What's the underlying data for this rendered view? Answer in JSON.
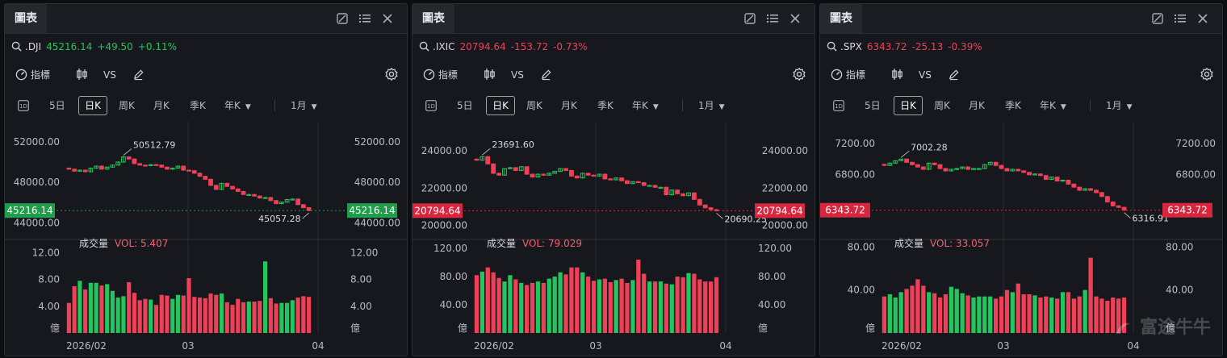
{
  "colors": {
    "up": "#22c55e",
    "down": "#ef4058",
    "grid": "#2a2c33",
    "label_green": "#1f9d4a",
    "label_red": "#d8263e"
  },
  "ui": {
    "tab_label": "圖表",
    "search_icon": "search-icon",
    "indicator_label": "指標",
    "vs_label": "VS",
    "periods": [
      "5日",
      "日K",
      "周K",
      "月K",
      "季K",
      "年K",
      "1月"
    ],
    "active_period": "日K",
    "volume_label": "成交量",
    "unit_label": "億",
    "x_labels": [
      "2026/02",
      "03",
      "04"
    ]
  },
  "watermark": "富途牛牛",
  "panels": [
    {
      "symbol": ".DJI",
      "price": "45216.14",
      "change": "+49.50",
      "change_pct": "+0.11%",
      "direction": "up",
      "y_ticks": [
        "52000.00",
        "48000.00",
        "44000.00"
      ],
      "current_label": "45216.14",
      "high_label": "50512.79",
      "low_label": "45057.28",
      "vol_text": "VOL: 5.407",
      "vol_ticks": [
        "12.00",
        "8.00",
        "4.00"
      ],
      "chart_data": {
        "type": "candlestick",
        "ylim": [
          43000,
          53500
        ],
        "vol_max": 13.5,
        "closes": [
          49300,
          49100,
          49200,
          49050,
          49400,
          49600,
          49300,
          49500,
          49700,
          50000,
          50513,
          50300,
          49850,
          49700,
          49650,
          49750,
          49700,
          49500,
          49300,
          49400,
          49600,
          49200,
          49150,
          48900,
          48600,
          48300,
          47700,
          47300,
          47900,
          47600,
          47350,
          47100,
          46800,
          46800,
          46650,
          46450,
          46500,
          46200,
          45900,
          46050,
          46300,
          46350,
          45800,
          45500,
          45216
        ],
        "volumes": [
          4.5,
          7.0,
          7.8,
          6.5,
          7.5,
          7.5,
          7.1,
          7.3,
          6.3,
          5.3,
          5.5,
          7.6,
          6.0,
          4.9,
          5.1,
          5.0,
          4.2,
          5.7,
          5.6,
          5.1,
          5.7,
          5.6,
          8.2,
          5.4,
          5.3,
          5.2,
          5.9,
          5.7,
          5.9,
          4.6,
          4.2,
          5.1,
          4.6,
          4.7,
          4.7,
          4.8,
          10.7,
          5.2,
          4.4,
          4.5,
          4.5,
          4.9,
          5.3,
          5.5,
          5.4
        ]
      }
    },
    {
      "symbol": ".IXIC",
      "price": "20794.64",
      "change": "-153.72",
      "change_pct": "-0.73%",
      "direction": "down",
      "y_ticks": [
        "24000.00",
        "22000.00",
        "20000.00"
      ],
      "current_label": "20794.64",
      "high_label": "23691.60",
      "low_label": "20690.25",
      "vol_text": "VOL: 79.029",
      "vol_ticks": [
        "120.00",
        "80.00",
        "40.00"
      ],
      "chart_data": {
        "type": "candlestick",
        "ylim": [
          19600,
          25300
        ],
        "vol_max": 128,
        "closes": [
          23500,
          23692,
          23300,
          22800,
          22700,
          23050,
          23100,
          22950,
          23150,
          22750,
          22600,
          22750,
          22700,
          22800,
          22900,
          23050,
          22950,
          22650,
          22550,
          22800,
          22700,
          22650,
          22750,
          22500,
          22450,
          22550,
          22400,
          22250,
          22350,
          22300,
          22150,
          22150,
          22050,
          22050,
          21650,
          21900,
          21700,
          21600,
          21750,
          21400,
          21100,
          20950,
          20850,
          20794
        ],
        "volumes": [
          82,
          87,
          93,
          86,
          78,
          73,
          82,
          76,
          71,
          68,
          71,
          73,
          71,
          77,
          80,
          86,
          83,
          93,
          93,
          86,
          80,
          74,
          76,
          77,
          72,
          75,
          77,
          71,
          75,
          104,
          84,
          73,
          73,
          73,
          70,
          69,
          80,
          79,
          85,
          84,
          76,
          73,
          73,
          79
        ]
      }
    },
    {
      "symbol": ".SPX",
      "price": "6343.72",
      "change": "-25.13",
      "change_pct": "-0.39%",
      "direction": "down",
      "y_ticks": [
        "7200.00",
        "6800.00"
      ],
      "current_label": "6343.72",
      "high_label": "7002.28",
      "low_label": "6316.91",
      "vol_text": "VOL: 33.057",
      "vol_ticks": [
        "80.00",
        "40.00"
      ],
      "chart_data": {
        "type": "candlestick",
        "ylim": [
          6050,
          7420
        ],
        "vol_max": 84,
        "closes": [
          6920,
          6950,
          6980,
          7002,
          6960,
          6930,
          6900,
          6870,
          6950,
          6930,
          6880,
          6850,
          6870,
          6880,
          6900,
          6870,
          6880,
          6880,
          6930,
          6960,
          6920,
          6880,
          6850,
          6870,
          6850,
          6830,
          6800,
          6810,
          6790,
          6740,
          6770,
          6720,
          6730,
          6680,
          6640,
          6600,
          6620,
          6600,
          6570,
          6520,
          6450,
          6400,
          6380,
          6344
        ],
        "volumes": [
          34,
          36,
          33,
          38,
          41,
          44,
          50,
          44,
          38,
          37,
          33,
          36,
          43,
          41,
          37,
          35,
          33,
          34,
          34,
          34,
          32,
          34,
          40,
          38,
          46,
          36,
          36,
          35,
          33,
          34,
          33,
          32,
          38,
          38,
          32,
          34,
          40,
          70,
          34,
          32,
          30,
          33,
          32,
          33
        ]
      }
    }
  ]
}
